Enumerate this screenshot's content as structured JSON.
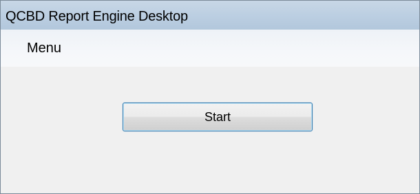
{
  "window": {
    "title": "QCBD Report Engine Desktop"
  },
  "menubar": {
    "items": [
      {
        "label": "Menu"
      }
    ]
  },
  "main": {
    "start_label": "Start"
  }
}
